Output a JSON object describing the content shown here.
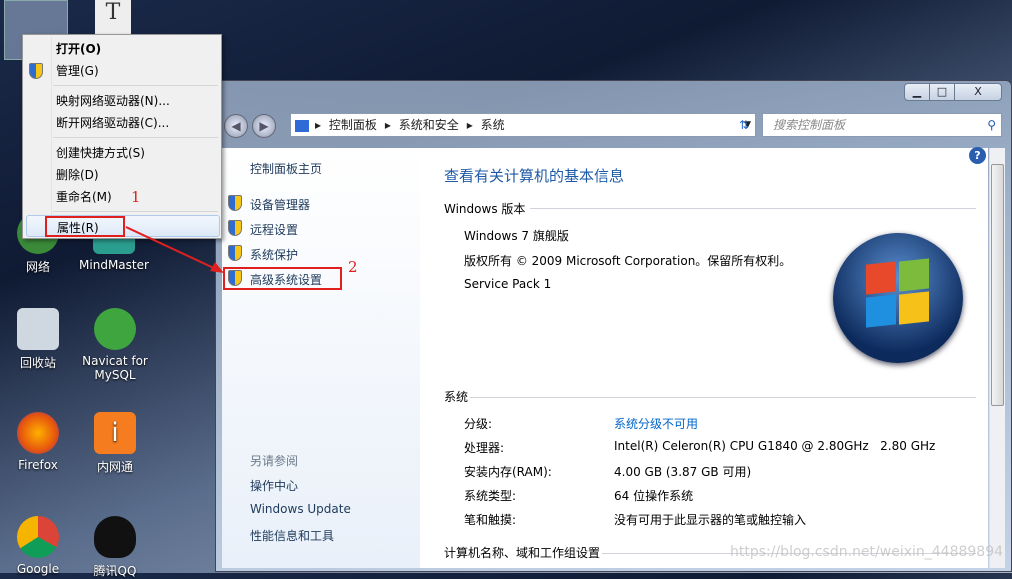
{
  "desktop": {
    "icons": [
      "网络",
      "MindMaster",
      "回收站",
      "Navicat for MySQL",
      "Firefox",
      "内网通",
      "Google",
      "腾讯QQ"
    ]
  },
  "context_menu": {
    "items": [
      "打开(O)",
      "管理(G)",
      "映射网络驱动器(N)...",
      "断开网络驱动器(C)...",
      "创建快捷方式(S)",
      "删除(D)",
      "重命名(M)",
      "属性(R)"
    ]
  },
  "annotations": {
    "step1": "1",
    "step2": "2"
  },
  "window": {
    "caption_buttons": {
      "minimize": "▁",
      "maximize": "□",
      "close": "X"
    },
    "breadcrumb": [
      "控制面板",
      "系统和安全",
      "系统"
    ],
    "search_placeholder": "搜索控制面板",
    "left_pane": {
      "home": "控制面板主页",
      "tasks": [
        "设备管理器",
        "远程设置",
        "系统保护",
        "高级系统设置"
      ],
      "see_also_title": "另请参阅",
      "see_also": [
        "操作中心",
        "Windows Update",
        "性能信息和工具"
      ]
    },
    "main": {
      "title": "查看有关计算机的基本信息",
      "edition_section": "Windows 版本",
      "edition": "Windows 7 旗舰版",
      "copyright": "版权所有 © 2009 Microsoft Corporation。保留所有权利。",
      "service_pack": "Service Pack 1",
      "system_section": "系统",
      "rows": [
        {
          "label": "分级:",
          "value": "系统分级不可用",
          "link": true
        },
        {
          "label": "处理器:",
          "value": "Intel(R) Celeron(R) CPU G1840 @ 2.80GHz   2.80 GHz"
        },
        {
          "label": "安装内存(RAM):",
          "value": "4.00 GB (3.87 GB 可用)"
        },
        {
          "label": "系统类型:",
          "value": "64 位操作系统"
        },
        {
          "label": "笔和触摸:",
          "value": "没有可用于此显示器的笔或触控输入"
        }
      ],
      "computer_section": "计算机名称、域和工作组设置"
    }
  },
  "watermark": "https://blog.csdn.net/weixin_44889894",
  "colors": {
    "link": "#0066cc",
    "title": "#1e5aa8",
    "annotation": "#e0201f"
  }
}
